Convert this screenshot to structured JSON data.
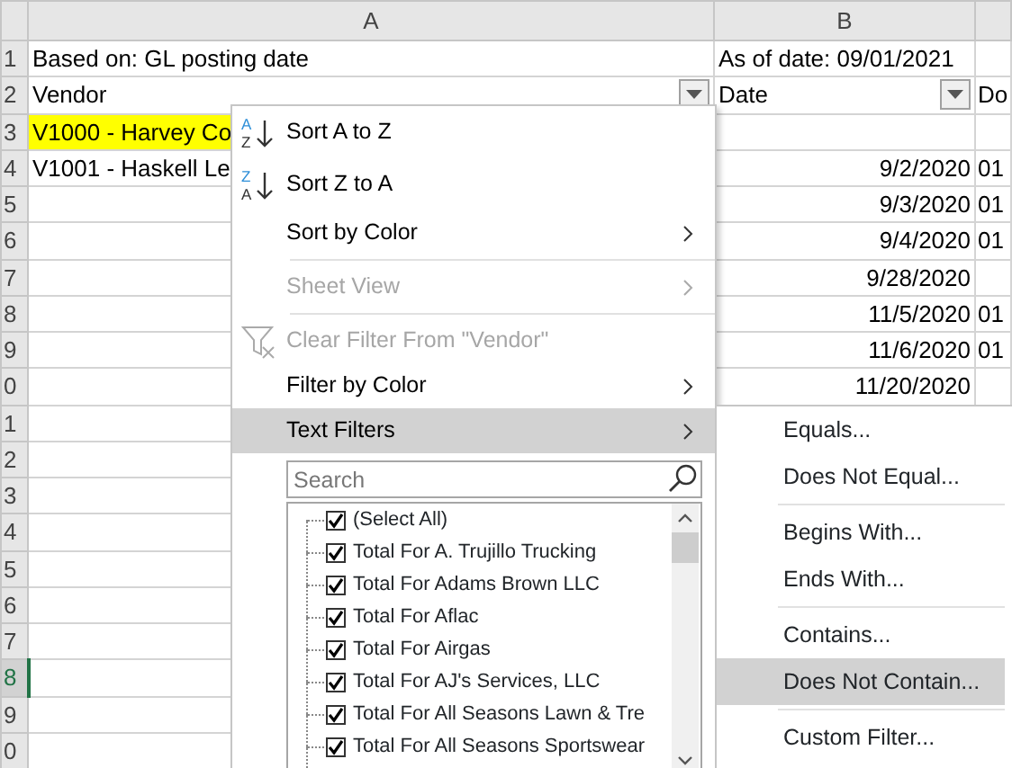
{
  "columns": [
    {
      "label": "A"
    },
    {
      "label": "B"
    }
  ],
  "rows": [
    {
      "number": "1",
      "selected": false,
      "cells": [
        {
          "kind": "text",
          "text": "Based on: GL posting date"
        },
        {
          "kind": "text",
          "text": "As of date: 09/01/2021"
        },
        {
          "kind": "text"
        }
      ]
    },
    {
      "number": "2",
      "selected": false,
      "cells": [
        {
          "kind": "text",
          "text": "Vendor",
          "filter": true
        },
        {
          "kind": "text",
          "text": "Date",
          "filter": true
        },
        {
          "kind": "text",
          "text": "Do"
        }
      ]
    },
    {
      "number": "3",
      "selected": false,
      "highlighted": true,
      "cells": [
        {
          "kind": "text",
          "text": "V1000 - Harvey Co"
        },
        {
          "kind": "text"
        },
        {
          "kind": "text"
        }
      ]
    },
    {
      "number": "4",
      "selected": false,
      "cells": [
        {
          "kind": "text",
          "text": "V1001 - Haskell Le"
        },
        {
          "kind": "date",
          "text": "9/2/2020"
        },
        {
          "kind": "text",
          "text": "01"
        }
      ]
    },
    {
      "number": "5",
      "selected": false,
      "cells": [
        {
          "kind": "text"
        },
        {
          "kind": "date",
          "text": "9/3/2020"
        },
        {
          "kind": "text",
          "text": "01"
        }
      ]
    },
    {
      "number": "6",
      "selected": false,
      "cells": [
        {
          "kind": "text"
        },
        {
          "kind": "date",
          "text": "9/4/2020"
        },
        {
          "kind": "text",
          "text": "01"
        }
      ]
    },
    {
      "number": "7",
      "selected": false,
      "cells": [
        {
          "kind": "text"
        },
        {
          "kind": "date",
          "text": "9/28/2020"
        },
        {
          "kind": "text"
        }
      ]
    },
    {
      "number": "8",
      "selected": false,
      "cells": [
        {
          "kind": "text"
        },
        {
          "kind": "date",
          "text": "11/5/2020"
        },
        {
          "kind": "text",
          "text": "01"
        }
      ]
    },
    {
      "number": "9",
      "selected": false,
      "cells": [
        {
          "kind": "text"
        },
        {
          "kind": "date",
          "text": "11/6/2020"
        },
        {
          "kind": "text",
          "text": "01"
        }
      ]
    },
    {
      "number": "0",
      "selected": false,
      "cells": [
        {
          "kind": "text"
        },
        {
          "kind": "date",
          "text": "11/20/2020"
        },
        {
          "kind": "text"
        }
      ]
    },
    {
      "number": "1",
      "selected": false,
      "cells": [
        {
          "kind": "text"
        },
        {
          "kind": "text"
        },
        {
          "kind": "text"
        }
      ]
    },
    {
      "number": "2",
      "selected": false,
      "cells": [
        {
          "kind": "text"
        },
        {
          "kind": "text"
        },
        {
          "kind": "text"
        }
      ]
    },
    {
      "number": "3",
      "selected": false,
      "cells": [
        {
          "kind": "text"
        },
        {
          "kind": "text"
        },
        {
          "kind": "text"
        }
      ]
    },
    {
      "number": "4",
      "selected": false,
      "cells": [
        {
          "kind": "text"
        },
        {
          "kind": "text"
        },
        {
          "kind": "text"
        }
      ]
    },
    {
      "number": "5",
      "selected": false,
      "cells": [
        {
          "kind": "text"
        },
        {
          "kind": "text"
        },
        {
          "kind": "text"
        }
      ]
    },
    {
      "number": "6",
      "selected": false,
      "cells": [
        {
          "kind": "text"
        },
        {
          "kind": "text"
        },
        {
          "kind": "text"
        }
      ]
    },
    {
      "number": "7",
      "selected": false,
      "cells": [
        {
          "kind": "text"
        },
        {
          "kind": "text"
        },
        {
          "kind": "text"
        }
      ]
    },
    {
      "number": "8",
      "selected": true,
      "cells": [
        {
          "kind": "text"
        },
        {
          "kind": "text"
        },
        {
          "kind": "text"
        }
      ]
    },
    {
      "number": "9",
      "selected": false,
      "cells": [
        {
          "kind": "text"
        },
        {
          "kind": "text"
        },
        {
          "kind": "text"
        }
      ]
    },
    {
      "number": "0",
      "selected": false,
      "cells": [
        {
          "kind": "text"
        },
        {
          "kind": "text"
        },
        {
          "kind": "text"
        }
      ]
    }
  ],
  "filter_menu": {
    "items": [
      {
        "kind": "sort",
        "icon_letters": [
          "A",
          "Z"
        ],
        "label": "Sort A to Z",
        "disabled": false,
        "highlighted": false,
        "submenu": false
      },
      {
        "kind": "sort",
        "icon_letters": [
          "Z",
          "A"
        ],
        "label": "Sort Z to A",
        "disabled": false,
        "highlighted": false,
        "submenu": false
      },
      {
        "kind": "command",
        "label": "Sort by Color",
        "disabled": false,
        "highlighted": false,
        "submenu": true
      },
      {
        "kind": "separator"
      },
      {
        "kind": "command",
        "label": "Sheet View",
        "disabled": true,
        "highlighted": false,
        "submenu": true
      },
      {
        "kind": "separator"
      },
      {
        "kind": "clear",
        "label": "Clear Filter From \"Vendor\"",
        "disabled": true,
        "highlighted": false,
        "submenu": false
      },
      {
        "kind": "command",
        "label": "Filter by Color",
        "disabled": false,
        "highlighted": false,
        "submenu": true
      },
      {
        "kind": "command",
        "label": "Text Filters",
        "disabled": false,
        "highlighted": true,
        "submenu": true
      }
    ],
    "search": {
      "placeholder": "Search"
    },
    "values": [
      {
        "label": "(Select All)",
        "checked": true
      },
      {
        "label": "Total For A. Trujillo Trucking",
        "checked": true
      },
      {
        "label": "Total For Adams Brown LLC",
        "checked": true
      },
      {
        "label": "Total For Aflac",
        "checked": true
      },
      {
        "label": "Total For Airgas",
        "checked": true
      },
      {
        "label": "Total For AJ's Services, LLC",
        "checked": true
      },
      {
        "label": "Total For All Seasons Lawn & Tre",
        "checked": true
      },
      {
        "label": "Total For All Seasons Sportswear",
        "checked": true
      }
    ]
  },
  "text_filters_menu": {
    "items": [
      {
        "kind": "command",
        "label": "Equals...",
        "highlighted": false
      },
      {
        "kind": "command",
        "label": "Does Not Equal...",
        "highlighted": false
      },
      {
        "kind": "separator"
      },
      {
        "kind": "command",
        "label": "Begins With...",
        "highlighted": false
      },
      {
        "kind": "command",
        "label": "Ends With...",
        "highlighted": false
      },
      {
        "kind": "separator"
      },
      {
        "kind": "command",
        "label": "Contains...",
        "highlighted": false
      },
      {
        "kind": "command",
        "label": "Does Not Contain...",
        "highlighted": true
      },
      {
        "kind": "separator"
      },
      {
        "kind": "command",
        "label": "Custom Filter...",
        "highlighted": false
      }
    ]
  }
}
